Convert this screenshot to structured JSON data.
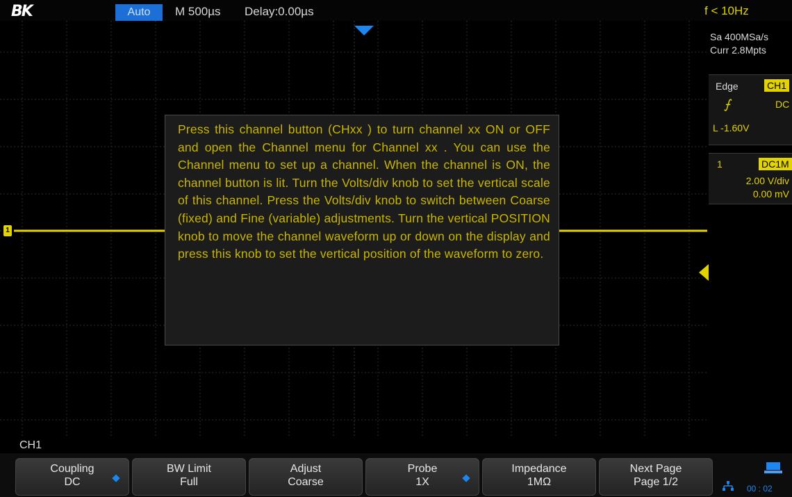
{
  "topbar": {
    "logo": "BK",
    "mode": "Auto",
    "timebase": "M 500µs",
    "delay": "Delay:0.00µs",
    "frequency": "f < 10Hz"
  },
  "acquisition": {
    "sample_rate": "Sa 400MSa/s",
    "memory": "Curr 2.8Mpts"
  },
  "trigger": {
    "type": "Edge",
    "source": "CH1",
    "slope_symbol": "⨍",
    "coupling": "DC",
    "level": "L  -1.60V"
  },
  "channel": {
    "number": "1",
    "coupling_impedance": "DC1M",
    "scale": "2.00 V/div",
    "offset": "0.00 mV",
    "marker": "1"
  },
  "help_popup": {
    "text": "Press this channel button (CHxx ) to turn channel xx ON or OFF and open the Channel menu for Channel xx . You can use the Channel menu to set up a channel. When the channel is ON, the channel button is lit. Turn the Volts/div knob to set the vertical scale of this channel. Press the Volts/div knob to switch between Coarse (fixed) and Fine (variable) adjustments. Turn the vertical POSITION knob to move the channel waveform up or down on the display and press this knob to set the vertical position of the waveform to zero."
  },
  "menu": {
    "title": "CH1",
    "softkeys": [
      {
        "label": "Coupling",
        "value": "DC"
      },
      {
        "label": "BW Limit",
        "value": "Full"
      },
      {
        "label": "Adjust",
        "value": "Coarse"
      },
      {
        "label": "Probe",
        "value": "1X"
      },
      {
        "label": "Impedance",
        "value": "1MΩ"
      },
      {
        "label": "Next Page",
        "value": "Page 1/2"
      }
    ]
  },
  "status": {
    "time": "00 : 02"
  },
  "colors": {
    "channel1": "#e3d400",
    "accent": "#1e86f0",
    "help_text": "#c9b600"
  }
}
